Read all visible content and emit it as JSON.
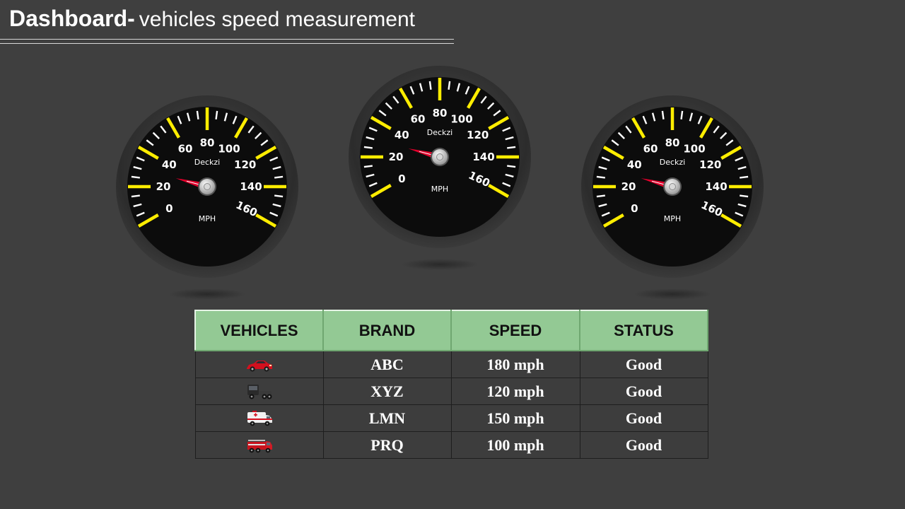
{
  "header": {
    "title_bold": "Dashboard-",
    "title_rest": "vehicles speed measurement"
  },
  "gauges": [
    {
      "brand_text": "Deckzi",
      "unit": "MPH",
      "needle_value": 30
    },
    {
      "brand_text": "Deckzi",
      "unit": "MPH",
      "needle_value": 30
    },
    {
      "brand_text": "Deckzi",
      "unit": "MPH",
      "needle_value": 30
    }
  ],
  "gauge_scale": {
    "min": 0,
    "max": 160,
    "labels": [
      "0",
      "20",
      "40",
      "60",
      "80",
      "100",
      "120",
      "140",
      "160"
    ]
  },
  "colors": {
    "background": "#3f3f3f",
    "tick_major": "#ffed00",
    "header_fill": "#93c994",
    "needle": "#e0002b"
  },
  "table": {
    "headers": [
      "VEHICLES",
      "BRAND",
      "SPEED",
      "STATUS"
    ],
    "rows": [
      {
        "vehicle_icon": "red-sports-car-icon",
        "brand": "ABC",
        "speed": "180 mph",
        "status": "Good"
      },
      {
        "vehicle_icon": "black-truck-icon",
        "brand": "XYZ",
        "speed": "120 mph",
        "status": "Good"
      },
      {
        "vehicle_icon": "ambulance-icon",
        "brand": "LMN",
        "speed": "150 mph",
        "status": "Good"
      },
      {
        "vehicle_icon": "fire-truck-icon",
        "brand": "PRQ",
        "speed": "100 mph",
        "status": "Good"
      }
    ]
  }
}
